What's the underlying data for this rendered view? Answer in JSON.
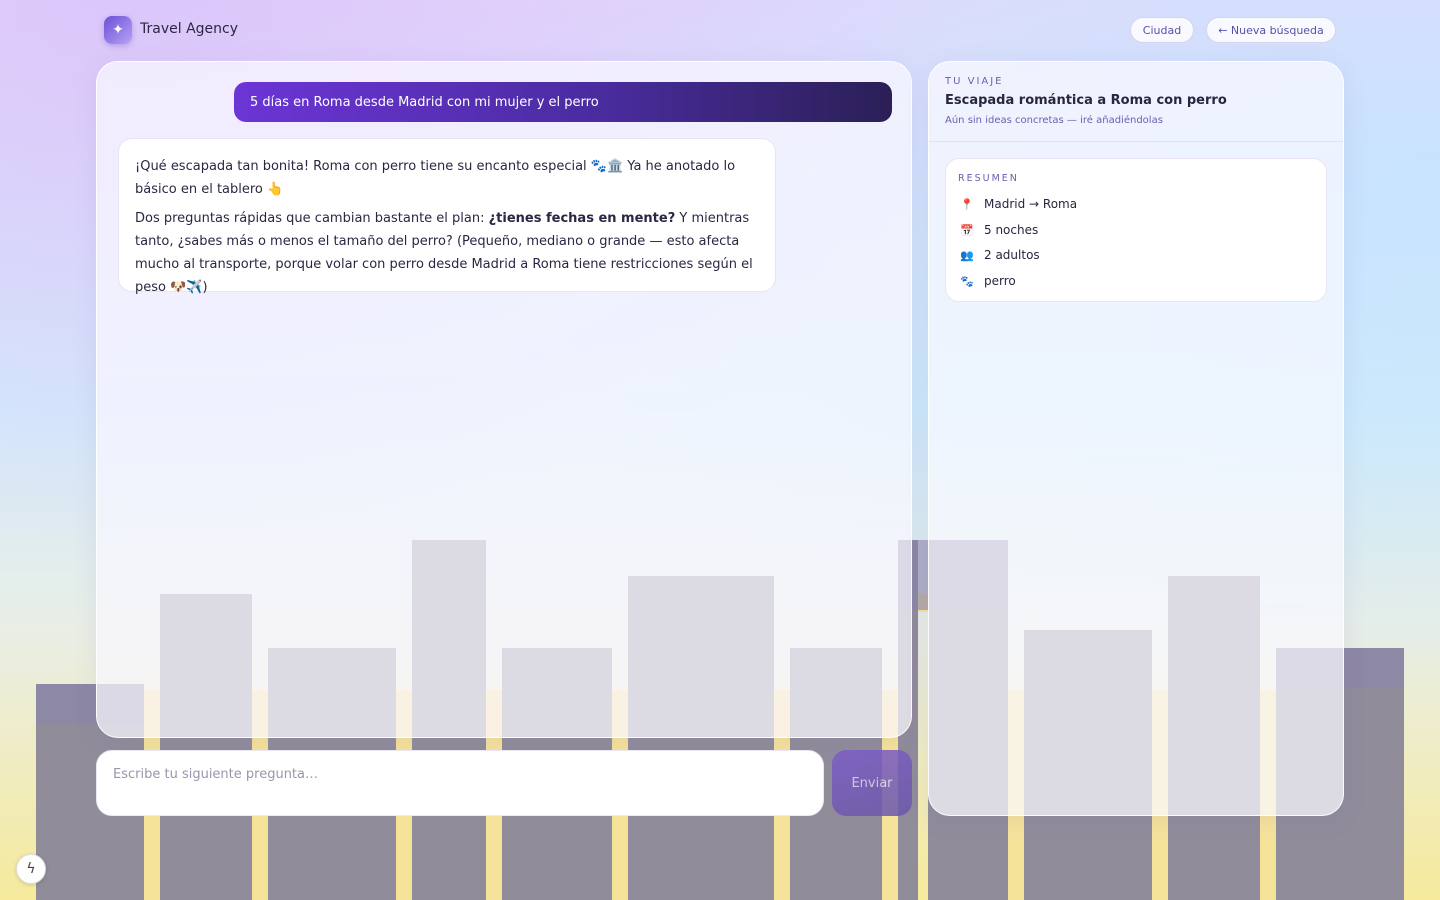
{
  "header": {
    "brand": "Travel Agency",
    "city_button": "Ciudad",
    "new_search_button": "← Nueva búsqueda"
  },
  "chat": {
    "user_message": "5 días en Roma desde Madrid con mi mujer y el perro",
    "bot_message": {
      "p1": "¡Qué escapada tan bonita! Roma con perro tiene su encanto especial 🐾🏛️ Ya he anotado lo básico en el tablero 👆",
      "p2_before": "Dos preguntas rápidas que cambian bastante el plan: ",
      "p2_bold": "¿tienes fechas en mente?",
      "p2_after": " Y mientras tanto, ¿sabes más o menos el tamaño del perro? (Pequeño, mediano o grande — esto afecta mucho al transporte, porque volar con perro desde Madrid a Roma tiene restricciones según el peso 🐶✈️)"
    }
  },
  "composer": {
    "placeholder": "Escribe tu siguiente pregunta…",
    "send_label": "Enviar"
  },
  "trip": {
    "eyebrow": "TU VIAJE",
    "title": "Escapada romántica a Roma con perro",
    "subtitle": "Aún sin ideas concretas — iré añadiéndolas",
    "summary": {
      "label": "RESUMEN",
      "route": "Madrid → Roma",
      "nights": "5 noches",
      "travelers": "2 adultos",
      "pet": "perro"
    }
  },
  "colors": {
    "accent": "#6c35d6",
    "accent_dark": "#2b1f55",
    "label": "#6a5fb0"
  }
}
